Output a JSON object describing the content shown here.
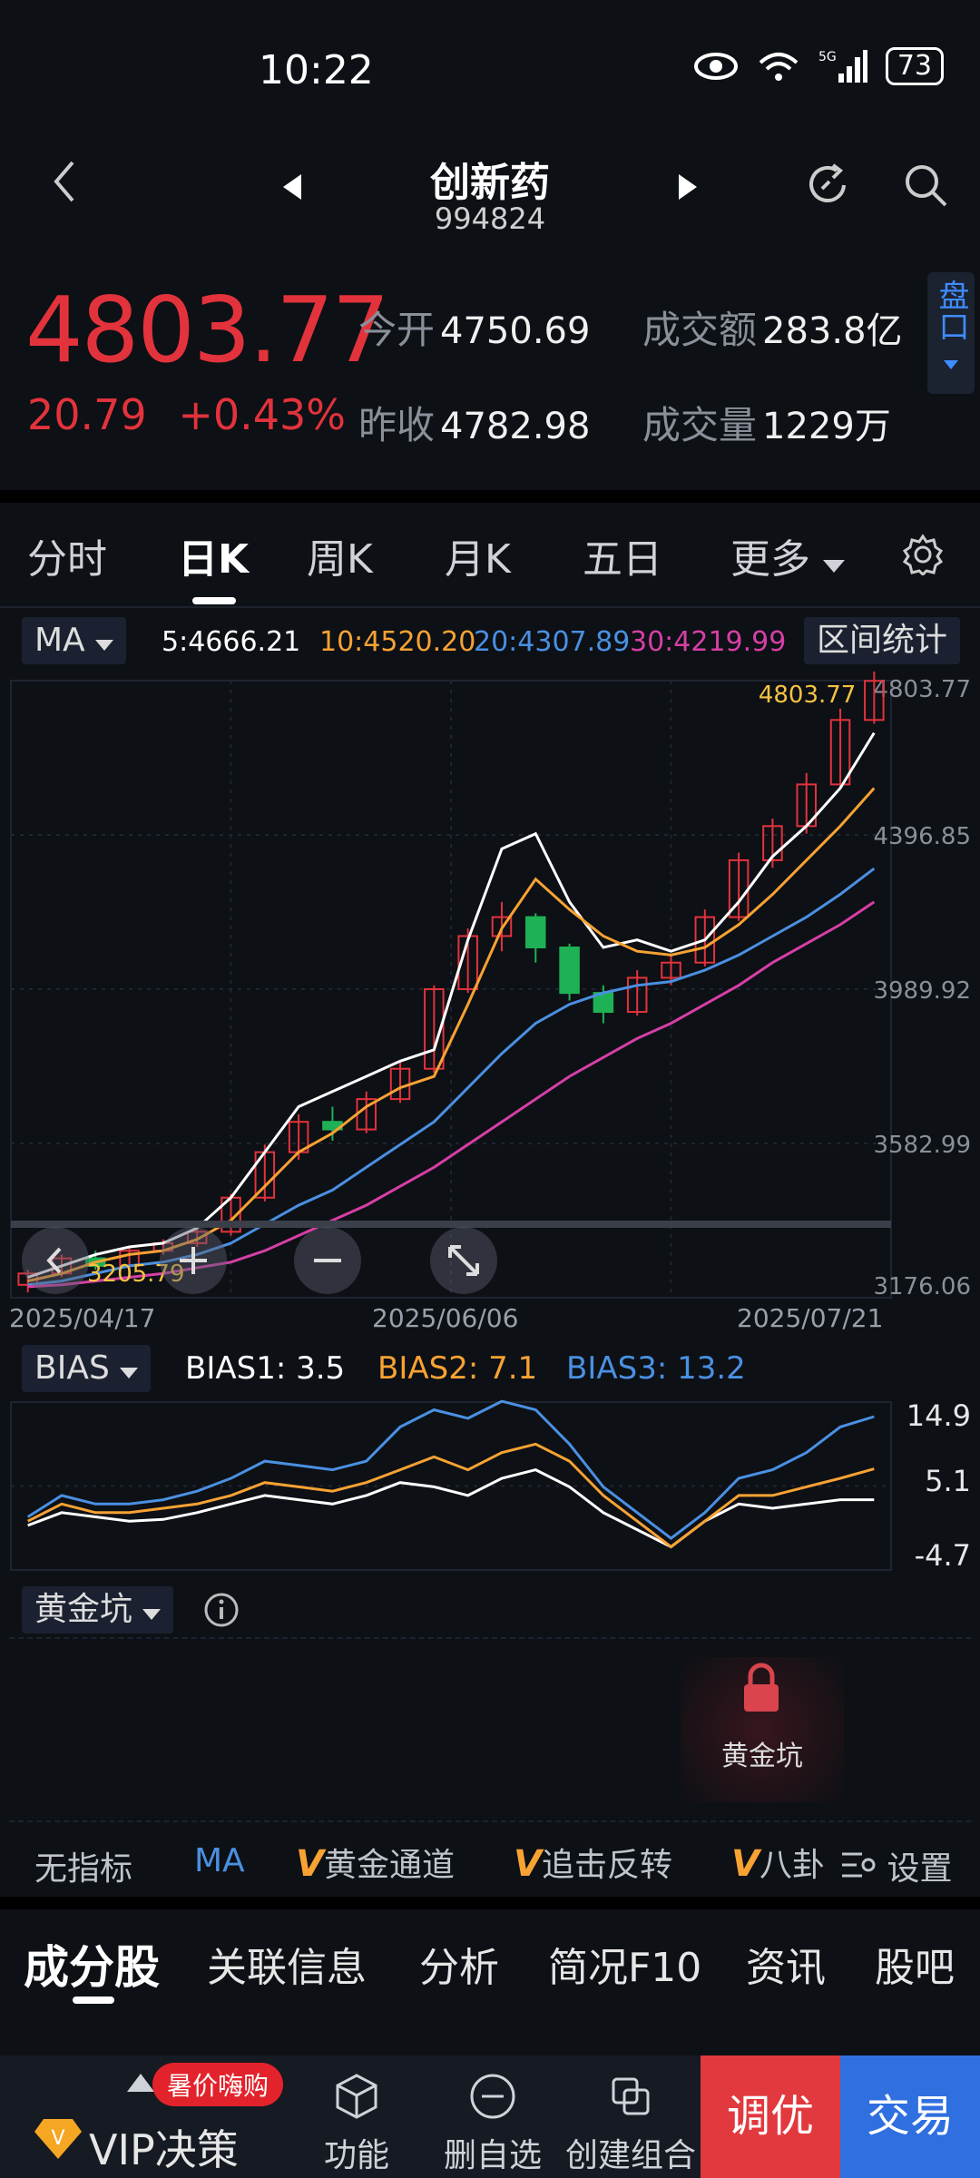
{
  "status": {
    "time": "10:22",
    "battery": "73",
    "signal": "5G"
  },
  "header": {
    "title": "创新药",
    "code": "994824"
  },
  "quote": {
    "price": "4803.77",
    "change": "20.79",
    "change_pct": "+0.43%",
    "open_label": "今开",
    "open": "4750.69",
    "prev_label": "昨收",
    "prev": "4782.98",
    "amount_label": "成交额",
    "amount": "283.8亿",
    "volume_label": "成交量",
    "volume": "1229万",
    "side_button": "盘口"
  },
  "tabs": [
    "分时",
    "日K",
    "周K",
    "月K",
    "五日",
    "更多"
  ],
  "ma": {
    "selector": "MA",
    "ma5": "5:4666.21",
    "ma10": "10:4520.20",
    "ma20": "20:4307.89",
    "ma30": "30:4219.99",
    "range_stats": "区间统计"
  },
  "kchart": {
    "price_labels": [
      "4803.77",
      "4396.85",
      "3989.92",
      "3582.99",
      "3176.06"
    ],
    "latest_label": "4803.77",
    "low_label": "3205.79",
    "dates": [
      "2025/04/17",
      "2025/06/06",
      "2025/07/21"
    ]
  },
  "bias": {
    "selector": "BIAS",
    "bias1": "BIAS1: 3.5",
    "bias2": "BIAS2: 7.1",
    "bias3": "BIAS3: 13.2",
    "axis": [
      "14.9",
      "5.1",
      "-4.7"
    ]
  },
  "gold": {
    "selector": "黄金坑",
    "lock_label": "黄金坑"
  },
  "indicators": [
    "无指标",
    "MA",
    "黄金通道",
    "追击反转",
    "八卦",
    "设置"
  ],
  "bottom_tabs": [
    "成分股",
    "关联信息",
    "分析",
    "简况F10",
    "资讯",
    "股吧"
  ],
  "nav": {
    "vip": "VIP决策",
    "promo": "暑价嗨购",
    "func": "功能",
    "remove": "删自选",
    "combo": "创建组合",
    "tune": "调优",
    "trade": "交易"
  },
  "colors": {
    "up": "#e2333c",
    "down": "#1fb155",
    "ma5": "#ffffff",
    "ma10": "#f7a233",
    "ma20": "#4a90e2",
    "ma30": "#d63fa6",
    "accent": "#3f8cff"
  },
  "chart_data": {
    "type": "line",
    "title": "创新药 日K",
    "x_range": [
      "2025/04/17",
      "2025/07/21"
    ],
    "ylim": [
      3176.06,
      4803.77
    ],
    "series": [
      {
        "name": "MA5",
        "values": [
          3230,
          3260,
          3290,
          3310,
          3320,
          3360,
          3440,
          3560,
          3680,
          3720,
          3760,
          3800,
          3830,
          4120,
          4360,
          4400,
          4220,
          4100,
          4120,
          4090,
          4120,
          4220,
          4340,
          4420,
          4520,
          4666
        ]
      },
      {
        "name": "MA10",
        "values": [
          3220,
          3240,
          3270,
          3290,
          3300,
          3330,
          3380,
          3470,
          3560,
          3610,
          3680,
          3730,
          3760,
          3950,
          4150,
          4280,
          4200,
          4130,
          4090,
          4080,
          4100,
          4160,
          4240,
          4330,
          4420,
          4520
        ]
      },
      {
        "name": "MA20",
        "values": [
          3210,
          3220,
          3240,
          3260,
          3270,
          3290,
          3320,
          3370,
          3420,
          3460,
          3520,
          3580,
          3640,
          3730,
          3820,
          3900,
          3950,
          3980,
          4000,
          4010,
          4040,
          4080,
          4130,
          4180,
          4240,
          4308
        ]
      },
      {
        "name": "MA30",
        "values": [
          3205,
          3210,
          3220,
          3230,
          3240,
          3255,
          3270,
          3300,
          3340,
          3380,
          3420,
          3470,
          3520,
          3580,
          3640,
          3700,
          3760,
          3810,
          3860,
          3900,
          3950,
          4000,
          4060,
          4110,
          4160,
          4220
        ]
      }
    ],
    "candles": [
      [
        3210,
        3240,
        3190,
        3250
      ],
      [
        3240,
        3280,
        3230,
        3290
      ],
      [
        3280,
        3260,
        3250,
        3300
      ],
      [
        3260,
        3300,
        3250,
        3310
      ],
      [
        3300,
        3320,
        3290,
        3330
      ],
      [
        3320,
        3350,
        3310,
        3360
      ],
      [
        3350,
        3440,
        3340,
        3450
      ],
      [
        3440,
        3560,
        3430,
        3580
      ],
      [
        3560,
        3640,
        3540,
        3660
      ],
      [
        3640,
        3620,
        3590,
        3680
      ],
      [
        3620,
        3700,
        3610,
        3720
      ],
      [
        3700,
        3780,
        3690,
        3800
      ],
      [
        3780,
        3990,
        3770,
        4000
      ],
      [
        3990,
        4130,
        3980,
        4150
      ],
      [
        4130,
        4180,
        4090,
        4220
      ],
      [
        4180,
        4100,
        4060,
        4190
      ],
      [
        4100,
        3980,
        3960,
        4110
      ],
      [
        3980,
        3930,
        3900,
        4000
      ],
      [
        3930,
        4020,
        3920,
        4040
      ],
      [
        4020,
        4060,
        4000,
        4080
      ],
      [
        4060,
        4180,
        4050,
        4200
      ],
      [
        4180,
        4330,
        4170,
        4350
      ],
      [
        4330,
        4420,
        4310,
        4440
      ],
      [
        4420,
        4530,
        4400,
        4560
      ],
      [
        4530,
        4700,
        4520,
        4730
      ],
      [
        4700,
        4803,
        4690,
        4830
      ]
    ],
    "bias": {
      "ylim": [
        -4.7,
        14.9
      ],
      "series": [
        {
          "name": "BIAS1",
          "values": [
            0.5,
            2,
            1.5,
            1,
            1.2,
            2,
            3,
            4,
            3.5,
            3,
            4,
            5.5,
            5,
            4,
            6,
            7,
            5,
            2,
            0,
            -2,
            1,
            3,
            2.5,
            3,
            3.5,
            3.5
          ]
        },
        {
          "name": "BIAS2",
          "values": [
            1,
            3,
            2,
            2,
            2.5,
            3,
            4,
            5.5,
            5,
            4.5,
            5.5,
            7,
            8.5,
            7,
            9,
            10,
            8,
            4,
            1,
            -2,
            1,
            4,
            4,
            5,
            6,
            7.1
          ]
        },
        {
          "name": "BIAS3",
          "values": [
            1.5,
            4,
            3,
            3,
            3.5,
            4.5,
            6,
            8,
            7.5,
            7,
            8,
            12,
            14,
            13,
            15,
            14,
            10,
            5,
            2,
            -1,
            2,
            6,
            7,
            9,
            12,
            13.2
          ]
        }
      ]
    }
  }
}
